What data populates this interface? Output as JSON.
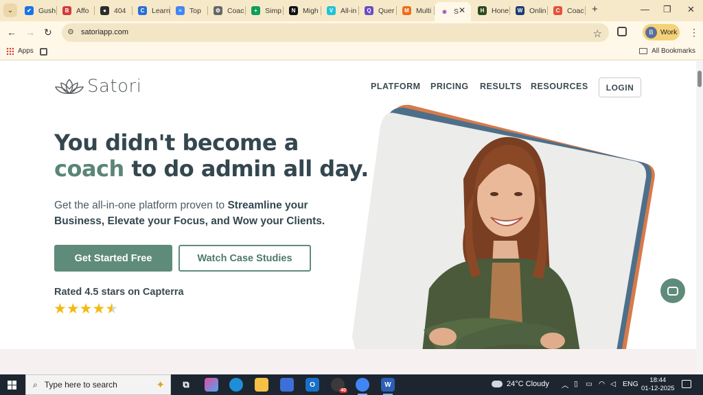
{
  "browser": {
    "tabs": [
      {
        "label": "Gush",
        "color": "#1a73e8",
        "glyph": "✔"
      },
      {
        "label": "Affo",
        "color": "#d23b3b",
        "glyph": "B"
      },
      {
        "label": "404",
        "color": "#2b2b2b",
        "glyph": "●"
      },
      {
        "label": "Learn",
        "color": "#2b6fd6",
        "glyph": "C"
      },
      {
        "label": "Top",
        "color": "#4285f4",
        "glyph": "≡"
      },
      {
        "label": "Coac",
        "color": "#666666",
        "glyph": "⚙"
      },
      {
        "label": "Simp",
        "color": "#0f9d58",
        "glyph": "+"
      },
      {
        "label": "Migh",
        "color": "#111111",
        "glyph": "N"
      },
      {
        "label": "All-in",
        "color": "#21c2d6",
        "glyph": "V"
      },
      {
        "label": "Quer",
        "color": "#6a4bc4",
        "glyph": "Q"
      },
      {
        "label": "Multi",
        "color": "#ef6c1a",
        "glyph": "M"
      },
      {
        "label": "S",
        "color": "#9b3fb8",
        "glyph": "❀",
        "active": true
      },
      {
        "label": "Hone",
        "color": "#2d4a1d",
        "glyph": "H"
      },
      {
        "label": "Onlin",
        "color": "#1f3b73",
        "glyph": "W"
      },
      {
        "label": "Coac",
        "color": "#e2533a",
        "glyph": "C"
      }
    ],
    "new_tab": "+",
    "window_controls": {
      "minimize": "—",
      "restore": "❐",
      "close": "✕"
    },
    "active_tab_close": "✕",
    "toolbar": {
      "back": "←",
      "forward": "→",
      "reload": "↻",
      "url": "satoriapp.com",
      "star": "☆",
      "profile_initial": "B",
      "profile_label": "Work",
      "menu": "⋮"
    },
    "bookmarks": {
      "apps": "Apps",
      "all_bookmarks": "All Bookmarks"
    }
  },
  "site": {
    "brand": "Satori",
    "nav": [
      "PLATFORM",
      "PRICING",
      "RESULTS",
      "RESOURCES"
    ],
    "login": "LOGIN",
    "headline_line1": "You didn't become a",
    "headline_accent": "coach",
    "headline_line2_rest": " to do admin all day.",
    "subhead_lead": "Get the all-in-one platform proven to ",
    "subhead_bold": "Streamline your Business, Elevate your Focus, and Wow your Clients.",
    "cta_primary": "Get Started Free",
    "cta_secondary": "Watch Case Studies",
    "rating_text": "Rated 4.5 stars on Capterra",
    "rating_value": 4.5,
    "rating_max": 5,
    "accent_color": "#5f8b7b"
  },
  "taskbar": {
    "search_placeholder": "Type here to search",
    "chrome_badge": "40",
    "weather": "24°C  Cloudy",
    "language": "ENG",
    "time": "18:44",
    "date": "01-12-2025",
    "notification_count": "5"
  }
}
